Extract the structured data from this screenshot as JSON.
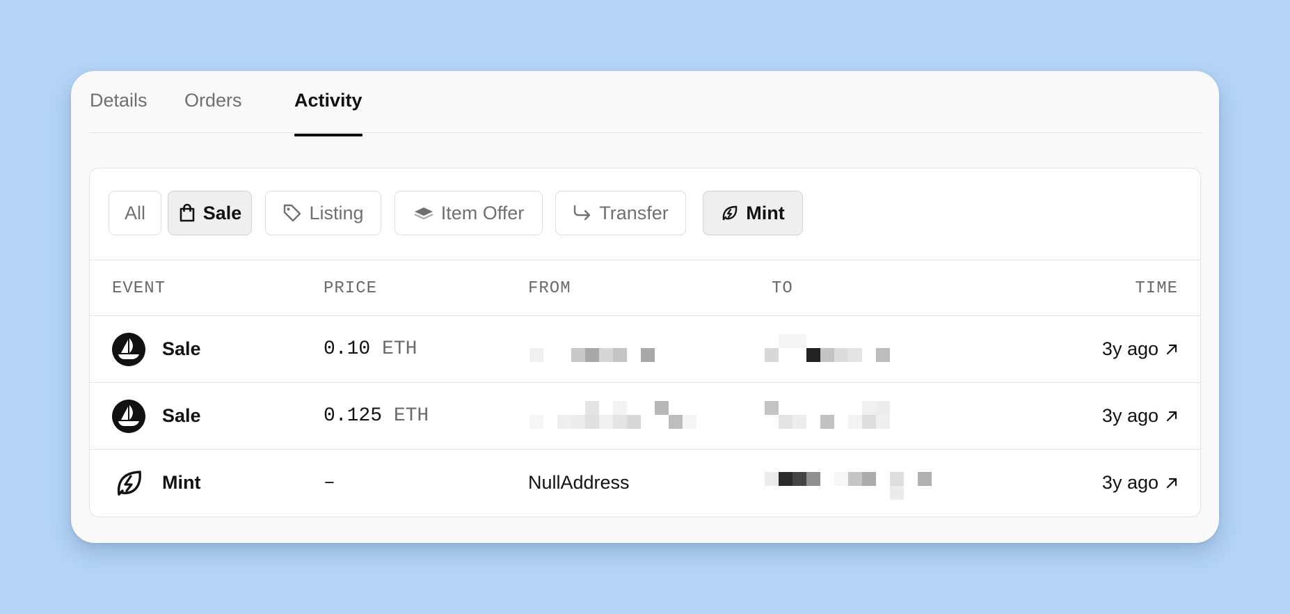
{
  "tabs": [
    {
      "label": "Details",
      "active": false
    },
    {
      "label": "Orders",
      "active": false
    },
    {
      "label": "Activity",
      "active": true
    }
  ],
  "filters": {
    "all": {
      "label": "All",
      "selected": false
    },
    "sale": {
      "label": "Sale",
      "selected": true,
      "icon": "shopping-bag-icon"
    },
    "listing": {
      "label": "Listing",
      "selected": false,
      "icon": "tag-icon"
    },
    "item_offer": {
      "label": "Item Offer",
      "selected": false,
      "icon": "layers-icon"
    },
    "transfer": {
      "label": "Transfer",
      "selected": false,
      "icon": "transfer-arrow-icon"
    },
    "mint": {
      "label": "Mint",
      "selected": true,
      "icon": "mint-leaf-icon"
    }
  },
  "columns": {
    "event": "EVENT",
    "price": "PRICE",
    "from": "FROM",
    "to": "TO",
    "time": "TIME"
  },
  "rows": [
    {
      "event": "Sale",
      "event_icon": "opensea-ship-icon",
      "price_amount": "0.10",
      "price_unit": "ETH",
      "from": "",
      "from_redacted": true,
      "to": "",
      "to_redacted": true,
      "time": "3y ago",
      "link_icon": "arrow-up-right-icon"
    },
    {
      "event": "Sale",
      "event_icon": "opensea-ship-icon",
      "price_amount": "0.125",
      "price_unit": "ETH",
      "from": "",
      "from_redacted": true,
      "to": "",
      "to_redacted": true,
      "time": "3y ago",
      "link_icon": "arrow-up-right-icon"
    },
    {
      "event": "Mint",
      "event_icon": "mint-leaf-icon",
      "price_amount": "–",
      "price_unit": "",
      "from": "NullAddress",
      "from_redacted": false,
      "to": "",
      "to_redacted": true,
      "time": "3y ago",
      "link_icon": "arrow-up-right-icon"
    }
  ],
  "colors": {
    "background": "#b3d4f5",
    "card": "#f9f9f9",
    "panel": "#ffffff",
    "text": "#111111",
    "muted": "#6f6f6f",
    "border": "#e3e3e3"
  }
}
